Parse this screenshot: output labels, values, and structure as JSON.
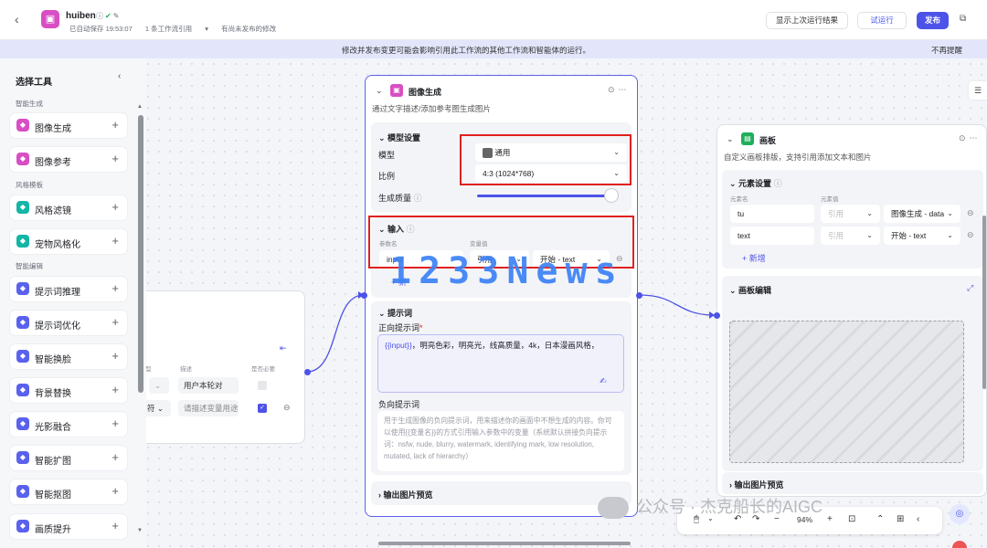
{
  "header": {
    "app_name": "huiben",
    "autosave": "已自动保存 19:53:07",
    "workflow_ref": "1 条工作流引用",
    "unpublished": "有尚未发布的修改",
    "btn_show_last": "显示上次运行结果",
    "btn_test": "试运行",
    "btn_publish": "发布"
  },
  "banner": {
    "text": "修改并发布变更可能会影响引用此工作流的其他工作流和智能体的运行。",
    "dismiss": "不再提醒"
  },
  "sidebar": {
    "title": "选择工具",
    "sections": [
      "智能生成",
      "风格模板",
      "智能编辑"
    ],
    "items": [
      {
        "label": "图像生成",
        "color": "#d84ec4",
        "icon": "image-gen-icon"
      },
      {
        "label": "图像参考",
        "color": "#d84ec4",
        "icon": "image-ref-icon"
      },
      {
        "label": "风格滤镜",
        "color": "#12b5a6",
        "icon": "filter-icon"
      },
      {
        "label": "宠物风格化",
        "color": "#12b5a6",
        "icon": "pet-icon"
      },
      {
        "label": "提示词推理",
        "color": "#5961ee",
        "icon": "prompt-infer-icon"
      },
      {
        "label": "提示词优化",
        "color": "#5961ee",
        "icon": "prompt-opt-icon"
      },
      {
        "label": "智能换脸",
        "color": "#5961ee",
        "icon": "face-swap-icon"
      },
      {
        "label": "背景替换",
        "color": "#5961ee",
        "icon": "bg-replace-icon"
      },
      {
        "label": "光影融合",
        "color": "#5961ee",
        "icon": "light-blend-icon"
      },
      {
        "label": "智能扩图",
        "color": "#5961ee",
        "icon": "expand-icon"
      },
      {
        "label": "智能抠图",
        "color": "#5961ee",
        "icon": "cutout-icon"
      },
      {
        "label": "画质提升",
        "color": "#5961ee",
        "icon": "enhance-icon"
      }
    ]
  },
  "start_node": {
    "col_type": "型",
    "col_desc": "描述",
    "col_required": "是否必要",
    "row1_desc": "用户本轮对",
    "row2_type": "符",
    "row2_desc": "请描述变量用途"
  },
  "image_node": {
    "title": "图像生成",
    "desc": "通过文字描述/添加参考图生成图片",
    "model_settings": "模型设置",
    "model_label": "模型",
    "model_value": "通用",
    "ratio_label": "比例",
    "ratio_value": "4:3 (1024*768)",
    "quality_label": "生成质量",
    "quality_value": 0.95,
    "input_title": "输入",
    "col_param": "参数名",
    "col_var": "变量值",
    "param_name": "input",
    "ref_type": "引用",
    "ref_value": "开始 - text",
    "add_label": "新",
    "prompt_title": "提示词",
    "positive_label": "正向提示词",
    "positive_var": "{{input}}",
    "positive_text": "，明亮色彩，明亮光，线高质量，4k，日本漫画风格，",
    "negative_label": "负向提示词",
    "negative_placeholder": "用于生成图像的负向提示词，用来描述你的画面中不想生成的内容。你可以使用{{变量名}}的方式引用输入参数中的变量（系统默认拼接负向提示词：nsfw, nude, blurry, watermark, identifying mark, low resolution, mutated, lack of hierarchy）",
    "output_preview": "输出图片预览"
  },
  "board_node": {
    "title": "画板",
    "desc": "自定义画板排版，支持引用添加文本和图片",
    "element_settings": "元素设置",
    "col_name": "元素名",
    "col_value": "元素值",
    "rows": [
      {
        "name": "tu",
        "type": "引用",
        "value": "图像生成 - data"
      },
      {
        "name": "text",
        "type": "引用",
        "value": "开始 - text"
      }
    ],
    "add_label": "新增",
    "board_edit": "画板编辑",
    "output_preview": "输出图片预览"
  },
  "toolbar": {
    "zoom": "94%"
  },
  "watermarks": {
    "big": "1233News",
    "wechat": "公众号 · 杰克船长的AIGC"
  }
}
